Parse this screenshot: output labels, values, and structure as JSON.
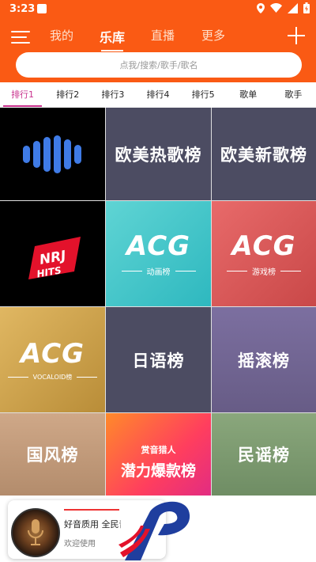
{
  "status": {
    "time": "3:23"
  },
  "header": {
    "tabs": [
      {
        "label": "我的"
      },
      {
        "label": "乐库"
      },
      {
        "label": "直播"
      },
      {
        "label": "更多"
      }
    ],
    "search_placeholder": "点我/搜索/歌手/歌名"
  },
  "subtabs": [
    "排行1",
    "排行2",
    "排行3",
    "排行4",
    "排行5",
    "歌单",
    "歌手"
  ],
  "tiles": [
    {
      "label": ""
    },
    {
      "label": "欧美热歌榜"
    },
    {
      "label": "欧美新歌榜"
    },
    {
      "label": "NRJ HITS"
    },
    {
      "label": "ACG",
      "sub": "动画榜"
    },
    {
      "label": "ACG",
      "sub": "游戏榜"
    },
    {
      "label": "ACG",
      "sub": "VOCALOID榜"
    },
    {
      "label": "日语榜"
    },
    {
      "label": "摇滚榜"
    },
    {
      "label": "国风榜"
    },
    {
      "label": "潜力爆款榜",
      "top": "赏音猎人"
    },
    {
      "label": "民谣榜"
    }
  ],
  "player": {
    "title": "好音质用 全民音乐",
    "subtitle": "欢迎使用"
  },
  "colors": {
    "accent": "#fa5a14",
    "subtab_active": "#c8308c"
  }
}
